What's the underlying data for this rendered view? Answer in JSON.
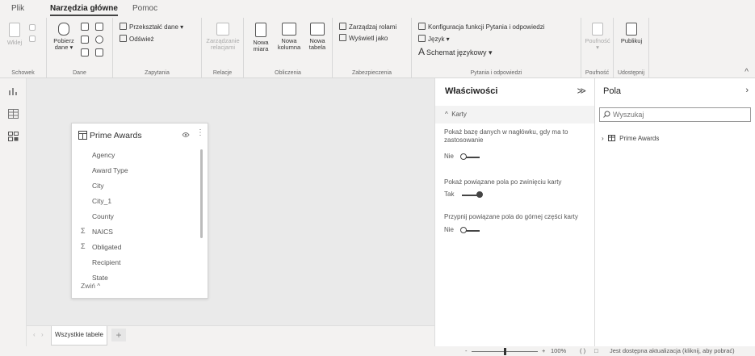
{
  "menu": {
    "file": "Plik",
    "home": "Narzędzia główne",
    "help": "Pomoc"
  },
  "ribbon": {
    "clipboard": {
      "paste": "Wklej",
      "group": "Schowek"
    },
    "data": {
      "get_data_1": "Pobierz",
      "get_data_2": "dane",
      "group": "Dane"
    },
    "queries": {
      "transform": "Przekształć dane",
      "refresh": "Odśwież",
      "group": "Zapytania"
    },
    "relations": {
      "manage_1": "Zarządzanie",
      "manage_2": "relacjami",
      "group": "Relacje"
    },
    "calc": {
      "new_measure_1": "Nowa",
      "new_measure_2": "miara",
      "new_column_1": "Nowa",
      "new_column_2": "kolumna",
      "new_table_1": "Nowa",
      "new_table_2": "tabela",
      "group": "Obliczenia"
    },
    "security": {
      "manage_roles": "Zarządzaj rolami",
      "view_as": "Wyświetl jako",
      "group": "Zabezpieczenia"
    },
    "qa": {
      "setup": "Konfiguracja funkcji Pytania i odpowiedzi",
      "language": "Język",
      "schema": "Schemat językowy",
      "group": "Pytania i odpowiedzi"
    },
    "sensitivity": {
      "label": "Poufność",
      "group": "Poufność"
    },
    "share": {
      "publish": "Publikuj",
      "group": "Udostępnij"
    }
  },
  "card": {
    "title": "Prime Awards",
    "fields": [
      "Agency",
      "Award Type",
      "City",
      "City_1",
      "County",
      "NAICS",
      "Obligated",
      "Recipient",
      "State"
    ],
    "collapse": "Zwiń ^"
  },
  "tabs": {
    "all_tables": "Wszystkie tabele",
    "add": "+"
  },
  "properties": {
    "title": "Właściwości",
    "chevron": "≫",
    "section": "Karty",
    "p1_label": "Pokaż bazę danych w nagłówku, gdy ma to zastosowanie",
    "p1_value": "Nie",
    "p2_label": "Pokaż powiązane pola po zwinięciu karty",
    "p2_value": "Tak",
    "p3_label": "Przypnij powiązane pola do górnej części karty",
    "p3_value": "Nie"
  },
  "fields_pane": {
    "title": "Pola",
    "chevron": "›",
    "search_placeholder": "Wyszukaj",
    "table_item": "Prime Awards"
  },
  "status": {
    "zoom_minus": "-",
    "zoom_plus": "+",
    "zoom": "100%",
    "zoom_level": 0.5,
    "update": "Jest dostępna aktualizacja (kliknij, aby pobrać)"
  },
  "colors": {
    "canvas": "#eaeaea",
    "chrome": "#f3f2f1",
    "pane": "#ffffff"
  }
}
